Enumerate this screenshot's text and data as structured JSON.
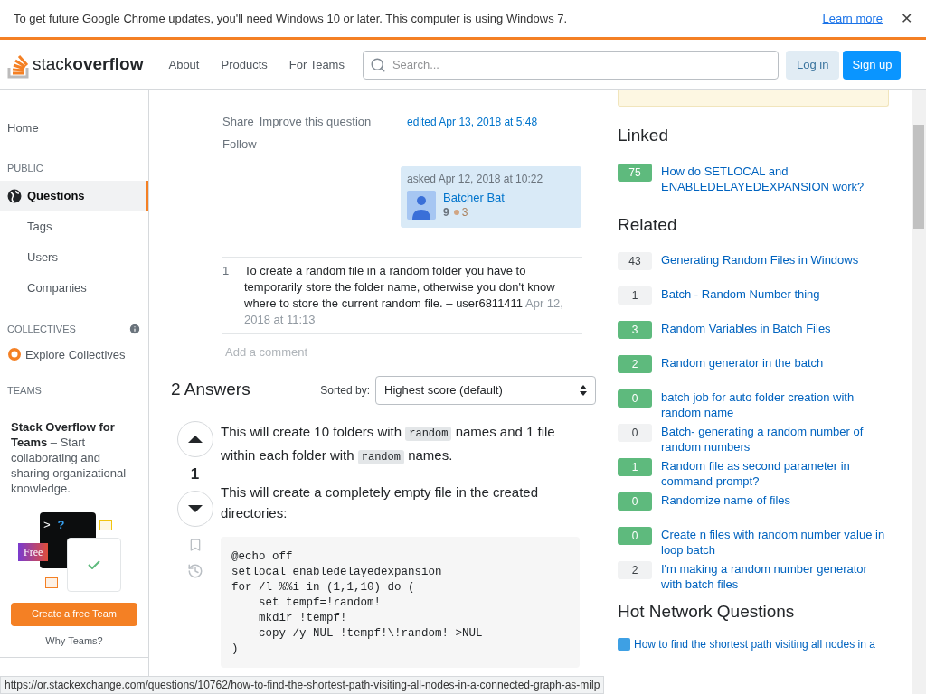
{
  "banner": {
    "text": "To get future Google Chrome updates, you'll need Windows 10 or later. This computer is using Windows 7.",
    "link": "Learn more",
    "close": "✕"
  },
  "header": {
    "logo_light": "stack",
    "logo_bold": "overflow",
    "nav": [
      "About",
      "Products",
      "For Teams"
    ],
    "search_placeholder": "Search...",
    "login": "Log in",
    "signup": "Sign up"
  },
  "sidebar": {
    "home": "Home",
    "public_label": "PUBLIC",
    "items": [
      {
        "label": "Questions",
        "selected": true,
        "kind": "globe"
      },
      {
        "label": "Tags",
        "selected": false,
        "kind": "plain"
      },
      {
        "label": "Users",
        "selected": false,
        "kind": "plain"
      },
      {
        "label": "Companies",
        "selected": false,
        "kind": "plain"
      }
    ],
    "collectives_label": "COLLECTIVES",
    "explore": "Explore Collectives",
    "teams_label": "TEAMS",
    "teams_card": {
      "title": "Stack Overflow for Teams",
      "text": " – Start collaborating and sharing organizational knowledge.",
      "prompt": ">_",
      "question": "?",
      "free": "Free",
      "button": "Create a free Team",
      "why": "Why Teams?"
    }
  },
  "question": {
    "actions": [
      "Share",
      "Improve this question",
      "Follow"
    ],
    "edited": "edited Apr 13, 2018 at 5:48",
    "asked": "asked Apr 12, 2018 at 10:22",
    "user": "Batcher Bat",
    "rep": "9",
    "bronze": "3",
    "comment": {
      "score": "1",
      "text": "To create a random file in a random folder you have to temporarily store the folder name, otherwise you don't know where to store the current random file. – ",
      "user": "user6811411",
      "date": "Apr 12, 2018 at 11:13"
    },
    "add_comment": "Add a comment"
  },
  "answers": {
    "title": "2 Answers",
    "sort_label": "Sorted by:",
    "sort_value": "Highest score (default)",
    "score": "1",
    "paragraphs": [
      [
        {
          "text": "This will create 10 folders with ",
          "code": false
        },
        {
          "text": "random",
          "code": true
        },
        {
          "text": " names and 1 file within each folder with ",
          "code": false
        },
        {
          "text": "random",
          "code": true
        },
        {
          "text": " names.",
          "code": false
        }
      ],
      [
        {
          "text": "This will create a completely empty file in the created directories:",
          "code": false
        }
      ]
    ],
    "code": "@echo off\nsetlocal enabledelayedexpansion\nfor /l %%i in (1,1,10) do (\n    set tempf=!random!\n    mkdir !tempf!\n    copy /y NUL !tempf!\\!random! >NUL\n)"
  },
  "linked": {
    "title": "Linked",
    "items": [
      {
        "score": "75",
        "answered": true,
        "title": "How do SETLOCAL and ENABLEDELAYEDEXPANSION work?"
      }
    ]
  },
  "related": {
    "title": "Related",
    "items": [
      {
        "score": "43",
        "answered": false,
        "title": "Generating Random Files in Windows"
      },
      {
        "score": "1",
        "answered": false,
        "title": "Batch - Random Number thing"
      },
      {
        "score": "3",
        "answered": true,
        "title": "Random Variables in Batch Files"
      },
      {
        "score": "2",
        "answered": true,
        "title": "Random generator in the batch"
      },
      {
        "score": "0",
        "answered": true,
        "title": "batch job for auto folder creation with random name"
      },
      {
        "score": "0",
        "answered": false,
        "title": "Batch- generating a random number of random numbers"
      },
      {
        "score": "1",
        "answered": true,
        "title": "Random file as second parameter in command prompt?"
      },
      {
        "score": "0",
        "answered": true,
        "title": "Randomize name of files"
      },
      {
        "score": "0",
        "answered": true,
        "title": "Create n files with random number value in loop batch"
      },
      {
        "score": "2",
        "answered": false,
        "title": "I'm making a random number generator with batch files"
      }
    ]
  },
  "hot": {
    "title": "Hot Network Questions",
    "items": [
      "How to find the shortest path visiting all nodes in a"
    ]
  },
  "status_url": "https://or.stackexchange.com/questions/10762/how-to-find-the-shortest-path-visiting-all-nodes-in-a-connected-graph-as-milp"
}
